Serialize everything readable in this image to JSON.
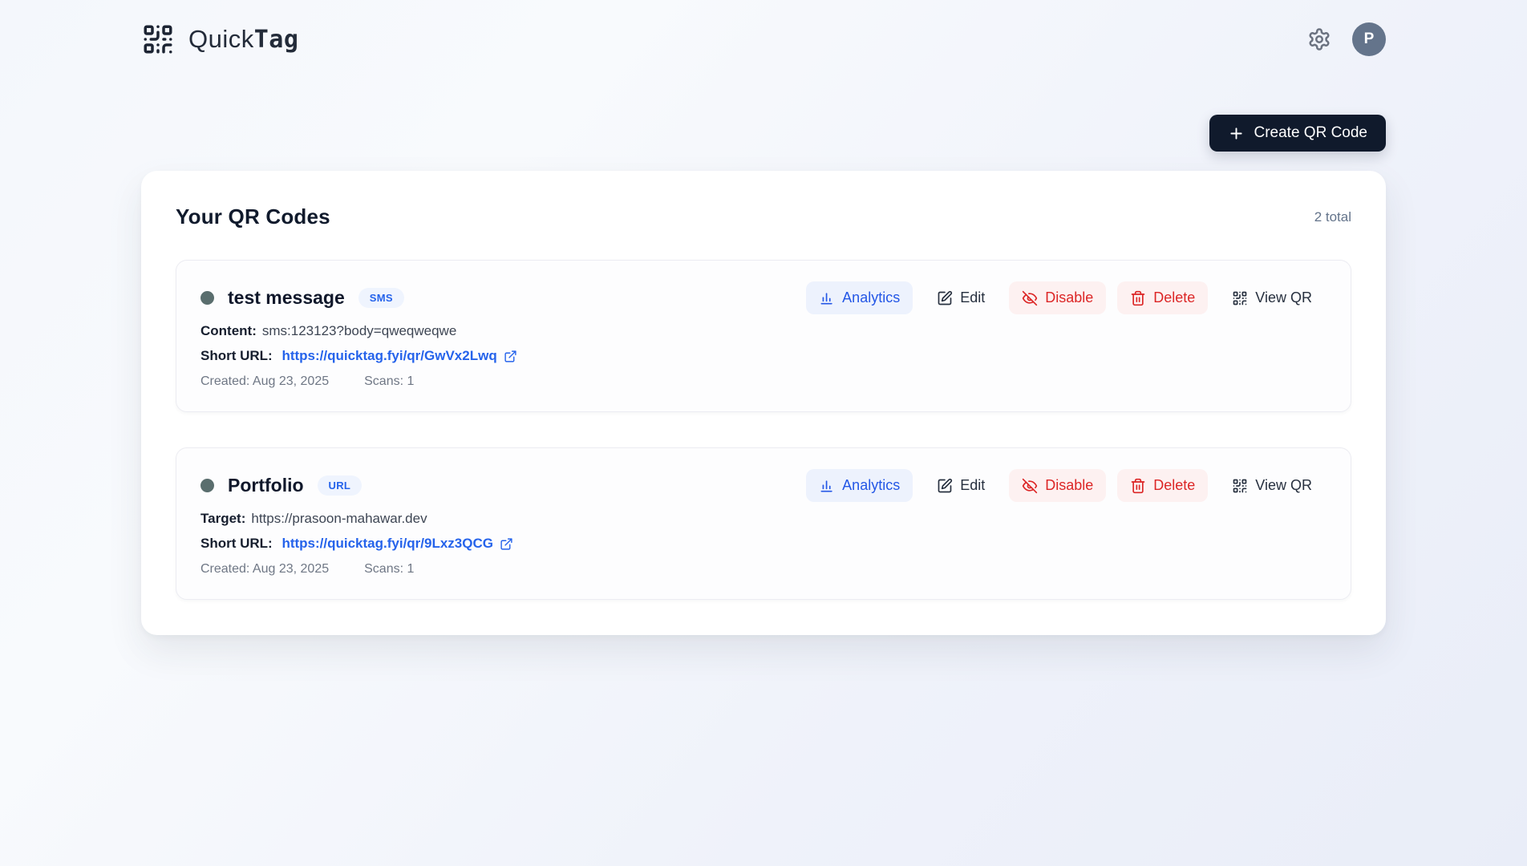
{
  "app": {
    "brand_quick": "Quick",
    "brand_tag": "Tag"
  },
  "header": {
    "avatar_initial": "P"
  },
  "create_button": {
    "label": "Create QR Code"
  },
  "panel": {
    "title": "Your QR Codes",
    "total": "2 total"
  },
  "actions": {
    "analytics": "Analytics",
    "edit": "Edit",
    "disable": "Disable",
    "delete": "Delete",
    "view_qr": "View QR"
  },
  "items": [
    {
      "name": "test message",
      "badge": "SMS",
      "field_label": "Content:",
      "field_value": "sms:123123?body=qweqweqwe",
      "short_url_label": "Short URL:",
      "short_url": "https://quicktag.fyi/qr/GwVx2Lwq",
      "created": "Created: Aug 23, 2025",
      "scans": "Scans: 1"
    },
    {
      "name": "Portfolio",
      "badge": "URL",
      "field_label": "Target:",
      "field_value": "https://prasoon-mahawar.dev",
      "short_url_label": "Short URL:",
      "short_url": "https://quicktag.fyi/qr/9Lxz3QCG",
      "created": "Created: Aug 23, 2025",
      "scans": "Scans: 1"
    }
  ],
  "colors": {
    "accent_blue": "#2563eb",
    "danger_red": "#dc2626",
    "dark_button_bg": "#101a2c",
    "badge_bg": "#eff4fe",
    "analytics_bg": "#edf2fd",
    "danger_bg": "#fdf1f1",
    "avatar_bg": "#64748b",
    "status_dot": "#5a6e6e"
  }
}
